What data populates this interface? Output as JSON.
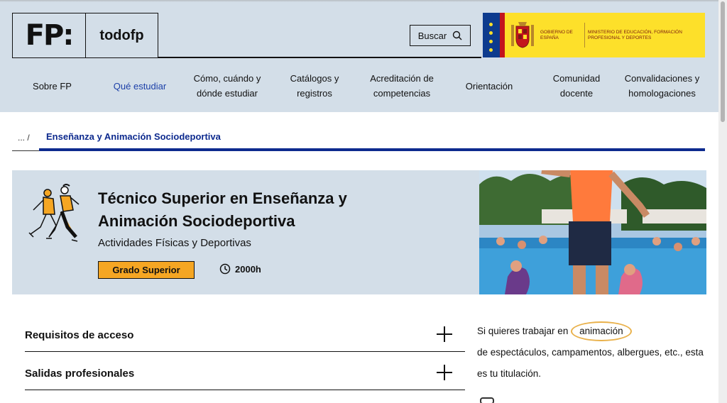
{
  "header": {
    "logo_mark": "FP:",
    "logo_text": "todofp",
    "search_label": "Buscar",
    "gov_left": "GOBIERNO DE ESPAÑA",
    "gov_right": "MINISTERIO DE EDUCACIÓN, FORMACIÓN PROFESIONAL Y DEPORTES"
  },
  "nav": {
    "items": [
      {
        "label": "Sobre FP",
        "active": false
      },
      {
        "label": "Qué estudiar",
        "active": true
      },
      {
        "label": "Cómo, cuándo y dónde estudiar",
        "active": false
      },
      {
        "label": "Catálogos y registros",
        "active": false
      },
      {
        "label": "Acreditación de competencias",
        "active": false
      },
      {
        "label": "Orientación",
        "active": false
      },
      {
        "label": "Comunidad docente",
        "active": false
      },
      {
        "label": "Convalidaciones y homologaciones",
        "active": false
      }
    ]
  },
  "breadcrumb": {
    "ellipsis": "... /",
    "current": "Enseñanza y Animación Sociodeportiva"
  },
  "hero": {
    "title": "Técnico Superior en Enseñanza y Animación Sociodeportiva",
    "family": "Actividades Físicas y Deportivas",
    "level": "Grado Superior",
    "hours": "2000h"
  },
  "accordion": [
    {
      "label": "Requisitos de acceso"
    },
    {
      "label": "Salidas profesionales"
    }
  ],
  "aside": {
    "text_before": "Si quieres trabajar en",
    "highlight": "animación",
    "text_after": "de espectáculos, campamentos, albergues, etc., esta es tu titulación."
  },
  "colors": {
    "header_bg": "#d3dee8",
    "brand_blue": "#0d2a8e",
    "badge_orange": "#f5a623",
    "gov_yellow": "#fde02a"
  }
}
